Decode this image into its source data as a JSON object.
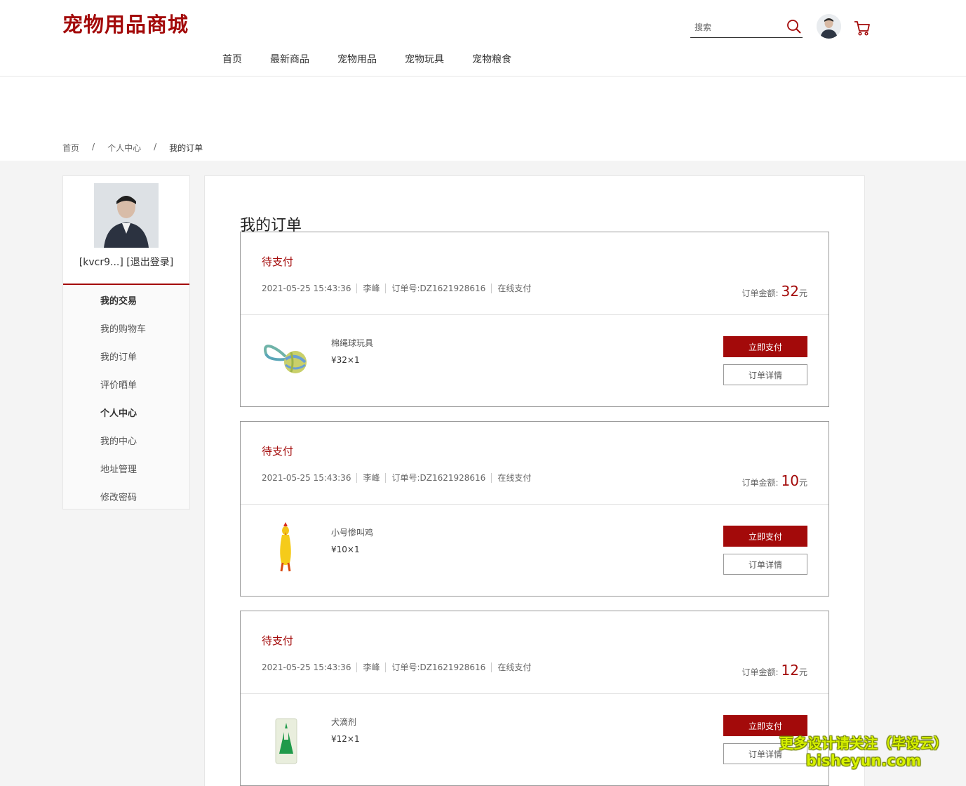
{
  "header": {
    "logo": "宠物用品商城",
    "search_placeholder": "搜索",
    "nav": [
      "首页",
      "最新商品",
      "宠物用品",
      "宠物玩具",
      "宠物粮食"
    ]
  },
  "breadcrumb": [
    "首页",
    "个人中心",
    "我的订单"
  ],
  "breadcrumb_sep": "/",
  "sidebar": {
    "username": "[kvcr9...]",
    "logout": "[退出登录]",
    "sections": [
      {
        "title": "我的交易",
        "items": [
          "我的购物车",
          "我的订单",
          "评价晒单"
        ]
      },
      {
        "title": "个人中心",
        "items": [
          "我的中心",
          "地址管理",
          "修改密码"
        ]
      }
    ]
  },
  "main": {
    "title": "我的订单",
    "amount_label": "订单金额:",
    "amount_unit": "元",
    "pay_label": "立即支付",
    "detail_label": "订单详情",
    "orders": [
      {
        "status": "待支付",
        "time": "2021-05-25 15:43:36",
        "name": "李峰",
        "order_no": "订单号:DZ1621928616",
        "pay_type": "在线支付",
        "amount": "32",
        "product": "棉绳球玩具",
        "price": "¥32×1",
        "image": "rope-ball-toy"
      },
      {
        "status": "待支付",
        "time": "2021-05-25 15:43:36",
        "name": "李峰",
        "order_no": "订单号:DZ1621928616",
        "pay_type": "在线支付",
        "amount": "10",
        "product": "小号惨叫鸡",
        "price": "¥10×1",
        "image": "screaming-chicken-toy"
      },
      {
        "status": "待支付",
        "time": "2021-05-25 15:43:36",
        "name": "李峰",
        "order_no": "订单号:DZ1621928616",
        "pay_type": "在线支付",
        "amount": "12",
        "product": "犬滴剂",
        "price": "¥12×1",
        "image": "dog-drops-package"
      }
    ]
  },
  "watermark": {
    "line1": "更多设计请关注（毕设云）",
    "line2": "bisheyun.com"
  },
  "colors": {
    "accent": "#a30a0a",
    "background": "#f4f4f4"
  }
}
